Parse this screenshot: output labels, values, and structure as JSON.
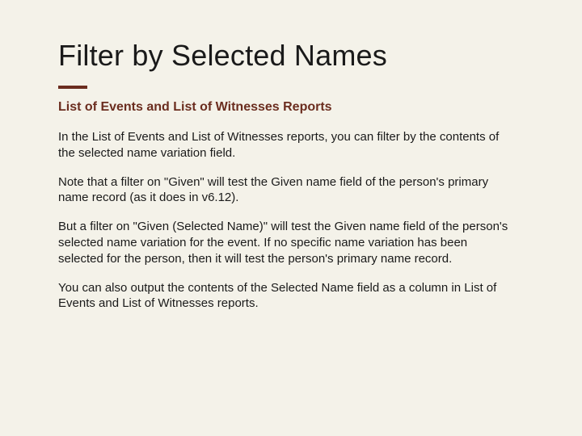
{
  "title": "Filter by Selected Names",
  "subtitle": "List of Events and List of Witnesses Reports",
  "paragraphs": [
    "In the List of Events and List of Witnesses reports, you can filter by the contents of the selected name variation field.",
    "Note that a filter on \"Given\" will test the Given name field of the person's primary name record (as it does in v6.12).",
    "But a filter on \"Given (Selected Name)\" will test the Given name field of the person's selected name variation for the event. If no specific name variation has been selected for the person, then it will test the person's primary name record.",
    "You can also output the contents of the Selected Name field as a column in List of Events and List of Witnesses reports."
  ]
}
